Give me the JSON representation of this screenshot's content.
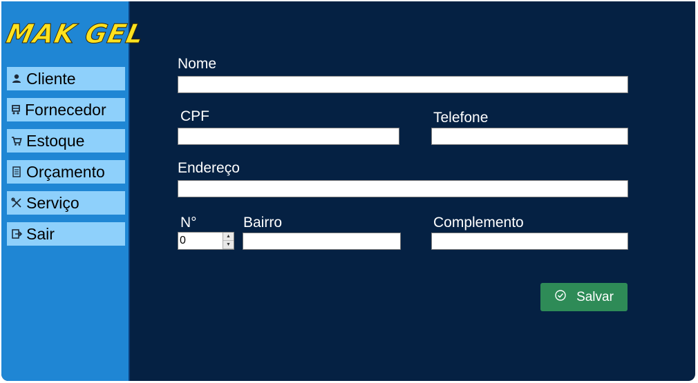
{
  "app": {
    "logo_text": "MAK GEL"
  },
  "sidebar": {
    "items": [
      {
        "label": "Cliente",
        "icon": "user-icon"
      },
      {
        "label": "Fornecedor",
        "icon": "truck-icon"
      },
      {
        "label": "Estoque",
        "icon": "cart-icon"
      },
      {
        "label": "Orçamento",
        "icon": "document-icon"
      },
      {
        "label": "Serviço",
        "icon": "tools-icon"
      },
      {
        "label": "Sair",
        "icon": "exit-icon"
      }
    ]
  },
  "form": {
    "nome_label": "Nome",
    "nome_value": "",
    "cpf_label": "CPF",
    "cpf_value": "",
    "telefone_label": "Telefone",
    "telefone_value": "",
    "endereco_label": "Endereço",
    "endereco_value": "",
    "numero_label": "N°",
    "numero_value": "0",
    "bairro_label": "Bairro",
    "bairro_value": "",
    "complemento_label": "Complemento",
    "complemento_value": "",
    "save_label": "Salvar"
  },
  "colors": {
    "background": "#052143",
    "sidebar": "#1f86d4",
    "nav_item": "#8ed0fb",
    "logo": "#ffe21f",
    "save_button": "#2e8b57"
  }
}
